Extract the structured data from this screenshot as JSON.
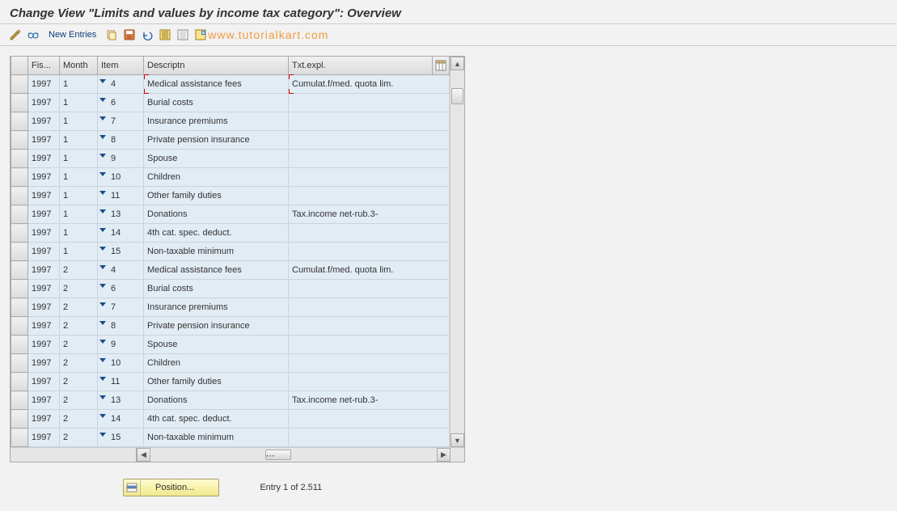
{
  "window": {
    "title": "Change View \"Limits and values by income tax category\": Overview"
  },
  "toolbar": {
    "new_entries": "New Entries"
  },
  "watermark": "www.tutorialkart.com",
  "table": {
    "headers": {
      "fis": "Fis...",
      "month": "Month",
      "item": "Item",
      "descr": "Descriptn",
      "txt": "Txt.expl."
    },
    "rows": [
      {
        "fis": "1997",
        "month": "1",
        "item": "4",
        "descr": "Medical assistance fees",
        "txt": "Cumulat.f/med. quota lim."
      },
      {
        "fis": "1997",
        "month": "1",
        "item": "6",
        "descr": "Burial costs",
        "txt": ""
      },
      {
        "fis": "1997",
        "month": "1",
        "item": "7",
        "descr": "Insurance premiums",
        "txt": ""
      },
      {
        "fis": "1997",
        "month": "1",
        "item": "8",
        "descr": "Private pension insurance",
        "txt": ""
      },
      {
        "fis": "1997",
        "month": "1",
        "item": "9",
        "descr": "Spouse",
        "txt": ""
      },
      {
        "fis": "1997",
        "month": "1",
        "item": "10",
        "descr": "Children",
        "txt": ""
      },
      {
        "fis": "1997",
        "month": "1",
        "item": "11",
        "descr": "Other family duties",
        "txt": ""
      },
      {
        "fis": "1997",
        "month": "1",
        "item": "13",
        "descr": "Donations",
        "txt": "Tax.income net-rub.3-"
      },
      {
        "fis": "1997",
        "month": "1",
        "item": "14",
        "descr": "4th cat. spec. deduct.",
        "txt": ""
      },
      {
        "fis": "1997",
        "month": "1",
        "item": "15",
        "descr": "Non-taxable minimum",
        "txt": ""
      },
      {
        "fis": "1997",
        "month": "2",
        "item": "4",
        "descr": "Medical assistance fees",
        "txt": "Cumulat.f/med. quota lim."
      },
      {
        "fis": "1997",
        "month": "2",
        "item": "6",
        "descr": "Burial costs",
        "txt": ""
      },
      {
        "fis": "1997",
        "month": "2",
        "item": "7",
        "descr": "Insurance premiums",
        "txt": ""
      },
      {
        "fis": "1997",
        "month": "2",
        "item": "8",
        "descr": "Private pension insurance",
        "txt": ""
      },
      {
        "fis": "1997",
        "month": "2",
        "item": "9",
        "descr": "Spouse",
        "txt": ""
      },
      {
        "fis": "1997",
        "month": "2",
        "item": "10",
        "descr": "Children",
        "txt": ""
      },
      {
        "fis": "1997",
        "month": "2",
        "item": "11",
        "descr": "Other family duties",
        "txt": ""
      },
      {
        "fis": "1997",
        "month": "2",
        "item": "13",
        "descr": "Donations",
        "txt": "Tax.income net-rub.3-"
      },
      {
        "fis": "1997",
        "month": "2",
        "item": "14",
        "descr": "4th cat. spec. deduct.",
        "txt": ""
      },
      {
        "fis": "1997",
        "month": "2",
        "item": "15",
        "descr": "Non-taxable minimum",
        "txt": ""
      }
    ]
  },
  "footer": {
    "position_btn": "Position...",
    "entry_text": "Entry 1 of 2.511"
  }
}
